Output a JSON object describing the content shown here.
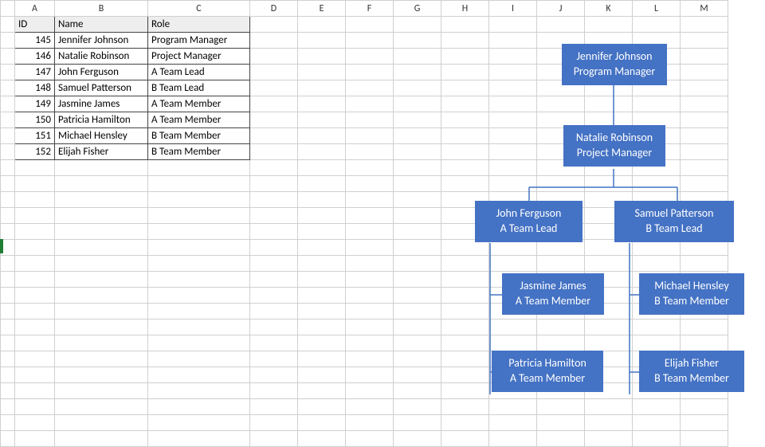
{
  "columns": [
    "A",
    "B",
    "C",
    "D",
    "E",
    "F",
    "G",
    "H",
    "I",
    "J",
    "K",
    "L",
    "M"
  ],
  "table": {
    "headers": {
      "id": "ID",
      "name": "Name",
      "role": "Role"
    },
    "rows": [
      {
        "id": "145",
        "name": "Jennifer Johnson",
        "role": "Program Manager"
      },
      {
        "id": "146",
        "name": "Natalie Robinson",
        "role": "Project Manager"
      },
      {
        "id": "147",
        "name": "John Ferguson",
        "role": "A Team Lead"
      },
      {
        "id": "148",
        "name": "Samuel Patterson",
        "role": "B Team Lead"
      },
      {
        "id": "149",
        "name": "Jasmine James",
        "role": "A Team Member"
      },
      {
        "id": "150",
        "name": "Patricia Hamilton",
        "role": "A Team Member"
      },
      {
        "id": "151",
        "name": "Michael Hensley",
        "role": "B Team Member"
      },
      {
        "id": "152",
        "name": "Elijah Fisher",
        "role": "B Team Member"
      }
    ]
  },
  "chart_data": {
    "type": "org-chart",
    "nodes": [
      {
        "id": 1,
        "name": "Jennifer Johnson",
        "role": "Program Manager",
        "parent": null
      },
      {
        "id": 2,
        "name": "Natalie Robinson",
        "role": "Project Manager",
        "parent": 1
      },
      {
        "id": 3,
        "name": "John Ferguson",
        "role": "A Team Lead",
        "parent": 2
      },
      {
        "id": 4,
        "name": "Samuel Patterson",
        "role": "B Team Lead",
        "parent": 2
      },
      {
        "id": 5,
        "name": "Jasmine James",
        "role": "A Team Member",
        "parent": 3
      },
      {
        "id": 6,
        "name": "Patricia Hamilton",
        "role": "A Team Member",
        "parent": 3
      },
      {
        "id": 7,
        "name": "Michael Hensley",
        "role": "B Team Member",
        "parent": 4
      },
      {
        "id": 8,
        "name": "Elijah Fisher",
        "role": "B Team Member",
        "parent": 4
      }
    ]
  },
  "org": {
    "n1": {
      "name": "Jennifer Johnson",
      "role": "Program Manager"
    },
    "n2": {
      "name": "Natalie Robinson",
      "role": "Project Manager"
    },
    "n3": {
      "name": "John Ferguson",
      "role": "A Team Lead"
    },
    "n4": {
      "name": "Samuel Patterson",
      "role": "B Team Lead"
    },
    "n5": {
      "name": "Jasmine James",
      "role": "A Team Member"
    },
    "n6": {
      "name": "Patricia Hamilton",
      "role": "A Team Member"
    },
    "n7": {
      "name": "Michael Hensley",
      "role": "B Team Member"
    },
    "n8": {
      "name": "Elijah Fisher",
      "role": "B Team Member"
    }
  },
  "colors": {
    "accent": "#4472C4"
  }
}
